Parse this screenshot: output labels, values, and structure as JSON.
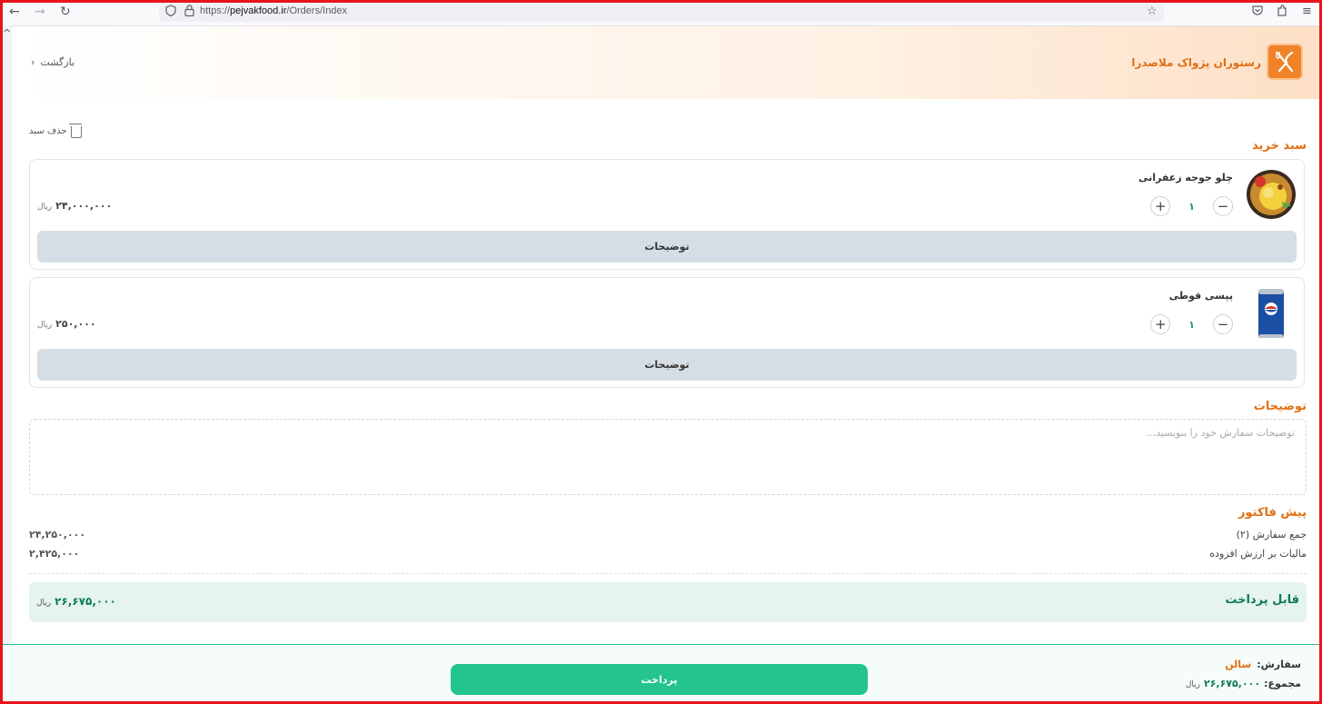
{
  "browser": {
    "url_prefix": "https://",
    "url_host": "pejvakfood.ir",
    "url_path": "/Orders/Index"
  },
  "header": {
    "restaurant_name": "رستوران پژواک ملاصدرا",
    "back_label": "بازگشت"
  },
  "cart": {
    "clear_label": "حذف سبد",
    "title": "سبد خرید",
    "items": [
      {
        "name": "چلو جوجه زعفرانی",
        "quantity": "۱",
        "price": "۲۴,۰۰۰,۰۰۰",
        "currency": "ریال",
        "notes_label": "توضیحات",
        "image": "saffron-chicken-rice-dish"
      },
      {
        "name": "پپسی قوطی",
        "quantity": "۱",
        "price": "۲۵۰,۰۰۰",
        "currency": "ریال",
        "notes_label": "توضیحات",
        "image": "pepsi-can"
      }
    ]
  },
  "order_notes": {
    "title": "توضیحات",
    "placeholder": "توضیحات سفارش خود را بنویسید..."
  },
  "invoice": {
    "title": "پیش فاکتور",
    "rows": [
      {
        "label": "جمع سفارش (۲)",
        "value": "۲۴,۲۵۰,۰۰۰"
      },
      {
        "label": "مالیات بر ارزش افزوده",
        "value": "۲,۴۲۵,۰۰۰"
      }
    ],
    "payable_label": "قابل پرداخت",
    "payable_amount": "۲۶,۶۷۵,۰۰۰",
    "currency": "ریال"
  },
  "footer": {
    "order_label": "سفارش:",
    "order_type": "سالن",
    "total_label": "مجموع:",
    "total_amount": "۲۶,۶۷۵,۰۰۰",
    "currency": "ریال",
    "pay_button": "پرداخت"
  },
  "colors": {
    "accent": "#e06f12",
    "primary_button": "#23c48e",
    "payable_text": "#0e7a55",
    "frame": "#e8141c"
  }
}
